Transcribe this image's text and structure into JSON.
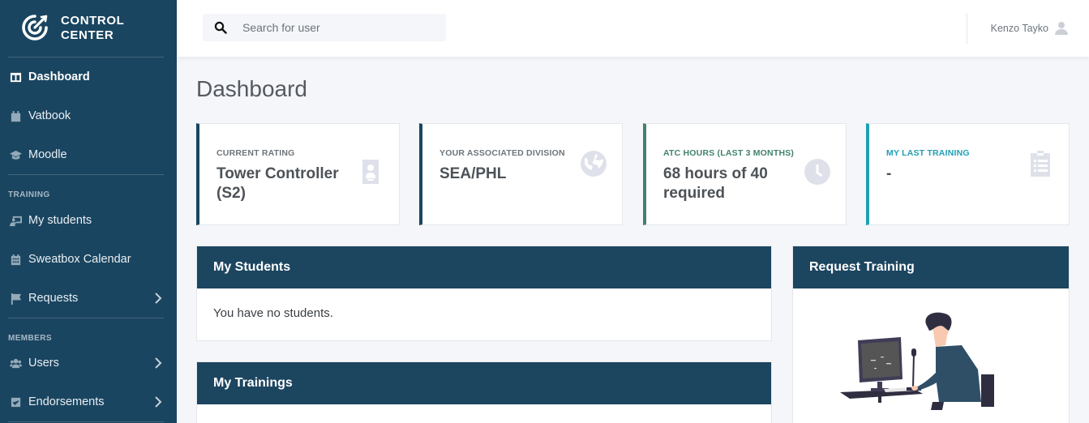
{
  "brand": {
    "line1": "CONTROL",
    "line2": "CENTER",
    "logo": "target-logo-icon"
  },
  "sidebar": {
    "items": [
      {
        "label": "Dashboard",
        "icon": "columns-icon",
        "active": true
      },
      {
        "label": "Vatbook",
        "icon": "calendar-icon"
      },
      {
        "label": "Moodle",
        "icon": "graduation-cap-icon"
      },
      {
        "label": "My students",
        "icon": "chalkboard-teacher-icon"
      },
      {
        "label": "Sweatbox Calendar",
        "icon": "calendar-grid-icon"
      },
      {
        "label": "Requests",
        "icon": "flag-icon",
        "expandable": true
      },
      {
        "label": "Users",
        "icon": "users-icon",
        "expandable": true
      },
      {
        "label": "Endorsements",
        "icon": "check-square-icon",
        "expandable": true
      }
    ],
    "sections": {
      "training": "TRAINING",
      "members": "MEMBERS"
    }
  },
  "topbar": {
    "search_placeholder": "Search for user",
    "user_name": "Kenzo Tayko"
  },
  "page": {
    "title": "Dashboard"
  },
  "cards": [
    {
      "label": "CURRENT RATING",
      "value": "Tower Controller (S2)",
      "accent": "#1a4560",
      "label_color": "#6c757d",
      "icon": "id-badge-icon"
    },
    {
      "label": "YOUR ASSOCIATED DIVISION",
      "value": "SEA/PHL",
      "accent": "#1a4560",
      "label_color": "#6c757d",
      "icon": "globe-icon"
    },
    {
      "label": "ATC HOURS (LAST 3 MONTHS)",
      "value": "68 hours of 40 required",
      "accent": "#41826e",
      "label_color": "#41826e",
      "icon": "clock-icon"
    },
    {
      "label": "MY LAST TRAINING",
      "value": "-",
      "accent": "#1ea0b3",
      "label_color": "#1ea0b3",
      "icon": "clipboard-list-icon"
    }
  ],
  "panels": {
    "students": {
      "title": "My Students",
      "body": "You have no students."
    },
    "trainings": {
      "title": "My Trainings"
    },
    "request": {
      "title": "Request Training"
    }
  },
  "colors": {
    "sidebar": "#1a4560",
    "panel_header": "#1c4560",
    "background": "#f4f6fa"
  }
}
